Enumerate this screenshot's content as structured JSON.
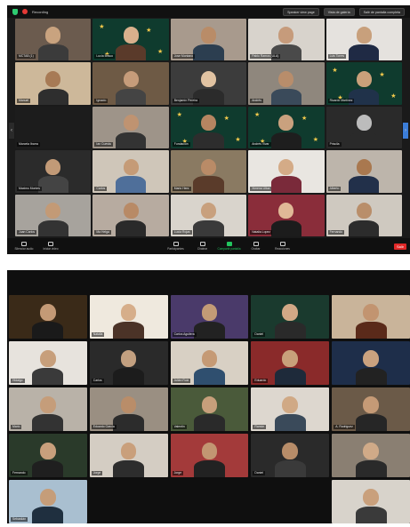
{
  "shot1": {
    "recording_label": "Recording",
    "view_buttons": [
      "Speaker view page",
      "Vista de galería",
      "Salir de pantalla completa"
    ],
    "tiles": [
      {
        "name": "MCTAB (1)",
        "wall": "#6b5b4e",
        "skin": "#c9a37f",
        "shirt": "#3b3b3b"
      },
      {
        "name": "Lucía Brisco",
        "wall": "#0f3b2e",
        "skin": "#d9b08c",
        "shirt": "#5a3a2a",
        "stars": true
      },
      {
        "name": "Jose Montano",
        "wall": "#a89a8d",
        "skin": "#b98c68",
        "shirt": "#2c3e50"
      },
      {
        "name": "Pablo Ramos (ULA)",
        "wall": "#d8d3cc",
        "skin": "#c69b7b",
        "shirt": "#4a4a4a"
      },
      {
        "name": "Luis Torres",
        "wall": "#e5e2de",
        "skin": "#c8a07c",
        "shirt": "#1f2a44"
      },
      {
        "name": "Manuel",
        "wall": "#cdb89a",
        "skin": "#a77a55",
        "shirt": "#2e2e2e"
      },
      {
        "name": "Ignacio",
        "wall": "#6e5a45",
        "skin": "#c69c7a",
        "shirt": "#444"
      },
      {
        "name": "Benjamín Pereira",
        "wall": "#3c3c3c",
        "skin": "#e1c3a2",
        "shirt": "#2b2b2b"
      },
      {
        "name": "Andrés",
        "wall": "#8f877d",
        "skin": "#b88d6b",
        "shirt": "#3a4a5a"
      },
      {
        "name": "Ricardo Martínez",
        "wall": "#0f3b2e",
        "skin": "#c9a07a",
        "shirt": "#20324a",
        "stars": true
      },
      {
        "name": "Marcela Ibarra",
        "wall": "#1c1c1c",
        "skin": "#1c1c1c",
        "shirt": "#1c1c1c",
        "dark": true
      },
      {
        "name": "Ian Cuesta",
        "wall": "#9e9489",
        "skin": "#bf9371",
        "shirt": "#333"
      },
      {
        "name": "Fundación",
        "wall": "#0f3b2e",
        "skin": "#b58561",
        "shirt": "#2d2d2d",
        "stars": true
      },
      {
        "name": "Andrés Vivar",
        "wall": "#0f3b2e",
        "skin": "#c9a17e",
        "shirt": "#1e1e1e",
        "stars": true
      },
      {
        "name": "Priscila",
        "wall": "#2a2a2a",
        "skin": "#bcbcbc",
        "shirt": "#2a2a2a"
      },
      {
        "name": "Maximo Montes",
        "wall": "#2b2b2b",
        "skin": "#c29a77",
        "shirt": "#444"
      },
      {
        "name": "Carlos",
        "wall": "#cfc6b9",
        "skin": "#c59b77",
        "shirt": "#4f6f9a"
      },
      {
        "name": "Mario Henr.",
        "wall": "#8a7a62",
        "skin": "#b98b67",
        "shirt": "#5a3b2a"
      },
      {
        "name": "Ximena Ulloa",
        "wall": "#e9e6e1",
        "skin": "#d4ab87",
        "shirt": "#7a2a3a"
      },
      {
        "name": "Alberto",
        "wall": "#bdb5ab",
        "skin": "#a9784f",
        "shirt": "#22304a"
      },
      {
        "name": "Juan Carlos",
        "wall": "#a7a39d",
        "skin": "#c39a76",
        "shirt": "#333"
      },
      {
        "name": "Ma Helga",
        "wall": "#b7aba0",
        "skin": "#b88a66",
        "shirt": "#2a2a2a"
      },
      {
        "name": "Lucía Rojas",
        "wall": "#d9d4cc",
        "skin": "#c8a07d",
        "shirt": "#3a3a3a"
      },
      {
        "name": "Natalia Lopez",
        "wall": "#8a2d3a",
        "skin": "#e0b997",
        "shirt": "#1c1c1c"
      },
      {
        "name": "Fernando",
        "wall": "#cfc9c0",
        "skin": "#b98e6a",
        "shirt": "#2c2c2c"
      }
    ],
    "controls": [
      "Silenciar audio",
      "Iniciar video",
      "Participantes",
      "Chatear",
      "Compartir pantalla",
      "Grabar",
      "Reacciones"
    ],
    "end_label": "Salir"
  },
  "shot2": {
    "tiles": [
      {
        "name": "",
        "wall": "#3a2a18",
        "skin": "#c49a76",
        "shirt": "#1a1a1a"
      },
      {
        "name": "Natalia",
        "wall": "#efe9de",
        "skin": "#d6ae8a",
        "shirt": "#4b3327"
      },
      {
        "name": "Carlos Aguilera",
        "wall": "#4a3a6a",
        "skin": "#c39b76",
        "shirt": "#222"
      },
      {
        "name": "Daniel",
        "wall": "#1a3a2e",
        "skin": "#d1a886",
        "shirt": "#2a2a2a"
      },
      {
        "name": "",
        "wall": "#c9b49a",
        "skin": "#c29470",
        "shirt": "#5a2a1a"
      },
      {
        "name": "Hidalgo",
        "wall": "#e7e3dd",
        "skin": "#c79f7b",
        "shirt": "#3a3a3a"
      },
      {
        "name": "Carlos",
        "wall": "#2a2a2a",
        "skin": "#c3a080",
        "shirt": "#1c1c1c"
      },
      {
        "name": "Julián Ruiz",
        "wall": "#d8d0c4",
        "skin": "#c59a75",
        "shirt": "#2f4f6f"
      },
      {
        "name": "Eduardo",
        "wall": "#8a2a2a",
        "skin": "#c8a07b",
        "shirt": "#1e2a3a"
      },
      {
        "name": "",
        "wall": "#1e2e4a",
        "skin": "#caa27f",
        "shirt": "#222"
      },
      {
        "name": "Mario",
        "wall": "#b9b2a8",
        "skin": "#c59d7a",
        "shirt": "#333"
      },
      {
        "name": "Eduardo García",
        "wall": "#9a8f82",
        "skin": "#b98d69",
        "shirt": "#2c2c2c"
      },
      {
        "name": "Valentín",
        "wall": "#4a5a3a",
        "skin": "#c79f7b",
        "shirt": "#2a2a2a",
        "speaking": true
      },
      {
        "name": "Ramón",
        "wall": "#ddd7cf",
        "skin": "#d0a985",
        "shirt": "#3a4a5a"
      },
      {
        "name": "A. Rodriguez",
        "wall": "#6b5a48",
        "skin": "#c59a76",
        "shirt": "#262626"
      },
      {
        "name": "Fernando",
        "wall": "#2a3a2a",
        "skin": "#c8a07c",
        "shirt": "#1f1f1f"
      },
      {
        "name": "Jorge",
        "wall": "#d4cdc3",
        "skin": "#c99f7b",
        "shirt": "#2d2d2d"
      },
      {
        "name": "Jorge",
        "wall": "#a33a3a",
        "skin": "#c29672",
        "shirt": "#222"
      },
      {
        "name": "Daniel",
        "wall": "#2a2a2a",
        "skin": "#b88d69",
        "shirt": "#3a3a3a"
      },
      {
        "name": "",
        "wall": "#8a7f72",
        "skin": "#d0aa88",
        "shirt": "#2a2a2a"
      },
      {
        "name": "Sebastián",
        "wall": "#a9bfd0",
        "skin": "#c59d79",
        "shirt": "#1f2f3f"
      },
      {
        "name": "",
        "empty": true
      },
      {
        "name": "",
        "empty": true
      },
      {
        "name": "",
        "empty": true
      },
      {
        "name": "",
        "wall": "#d8d3cb",
        "skin": "#c9a07c",
        "shirt": "#3a3a3a"
      }
    ]
  }
}
